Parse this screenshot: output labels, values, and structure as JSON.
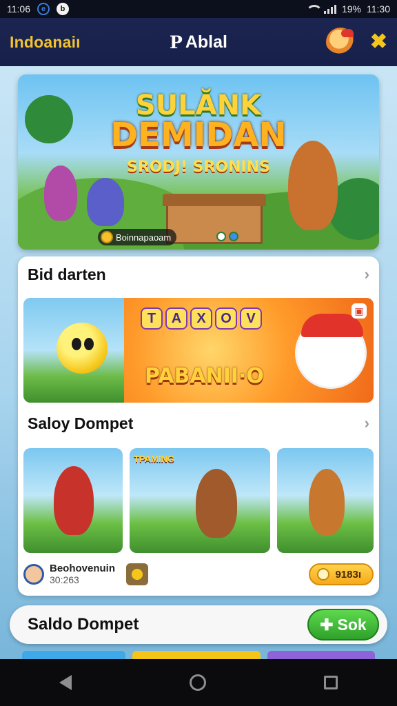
{
  "status_bar": {
    "time": "11:06",
    "battery": "19%",
    "clock_right": "11:30"
  },
  "header": {
    "left_label": "Indoanaiı",
    "title": "Ablal",
    "logo_glyph": "P"
  },
  "hero": {
    "title_line1": "SULĂNK",
    "title_line2": "DEMIDAN",
    "title_line3": "SRODJ! SRONINS",
    "caption": "Boinnapaoam"
  },
  "section1": {
    "title": "Bid darten",
    "feature_title": "PABANII·O",
    "tiles": [
      "T",
      "A",
      "X",
      "O",
      "V"
    ]
  },
  "section2": {
    "title": "Saloy Dompet",
    "thumb_label": "TPAMING",
    "game_name": "Beohovenuin",
    "game_sub": "30:263",
    "coin_value": "9183ı"
  },
  "wallet": {
    "title": "Saldo Dompet",
    "button_label": "Sok",
    "button_icon": "arrow-left-icon"
  },
  "colors": {
    "header_bg": "#1b2550",
    "header_accent": "#f1c232",
    "button_green": "#2ea12a",
    "coin_gold": "#f7a91a"
  }
}
